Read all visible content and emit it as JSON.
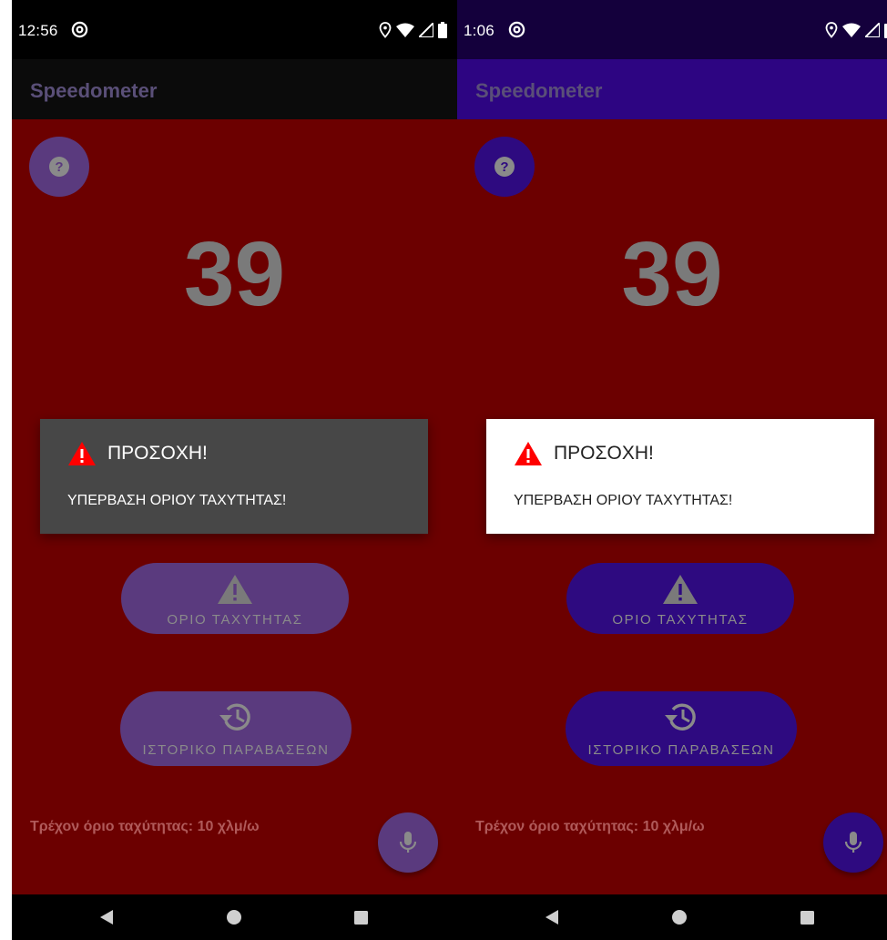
{
  "left": {
    "time": "12:56",
    "app_title": "Speedometer",
    "speed": "39",
    "dialog_title": "ΠΡΟΣΟΧΗ!",
    "dialog_message": "ΥΠΕΡΒΑΣΗ ΟΡΙΟΥ ΤΑΧΥΤΗΤΑΣ!",
    "speed_limit_button": "ΟΡΙΟ ΤΑΧΥΤΗΤΑΣ",
    "history_button": "ΙΣΤΟΡΙΚΟ ΠΑΡΑΒΑΣΕΩΝ",
    "current_limit_text": "Τρέχον όριο ταχύτητας: 10 χλμ/ω"
  },
  "right": {
    "time": "1:06",
    "app_title": "Speedometer",
    "speed": "39",
    "dialog_title": "ΠΡΟΣΟΧΗ!",
    "dialog_message": "ΥΠΕΡΒΑΣΗ ΟΡΙΟΥ ΤΑΧΥΤΗΤΑΣ!",
    "speed_limit_button": "ΟΡΙΟ ΤΑΧΥΤΗΤΑΣ",
    "history_button": "ΙΣΤΟΡΙΚΟ ΠΑΡΑΒΑΣΕΩΝ",
    "current_limit_text": "Τρέχον όριο ταχύτητας: 10 χλμ/ω"
  },
  "icons": {
    "status": [
      "at-sign-icon",
      "location-icon",
      "wifi-icon",
      "signal-icon",
      "battery-icon"
    ],
    "help": "help-icon",
    "warning": "warning-icon",
    "history": "history-icon",
    "mic": "mic-icon",
    "nav": [
      "back-icon",
      "home-icon",
      "recents-icon"
    ]
  },
  "colors": {
    "content_bg": "#6c0000",
    "left_status_bar": "#000000",
    "left_app_bar": "#0b0b0b",
    "left_dialog_bg": "#474747",
    "left_accent": "#5a3a7e",
    "right_status_bar": "#14003c",
    "right_app_bar": "#2d0582",
    "right_dialog_bg": "#ffffff",
    "right_accent": "#2e0a80",
    "warning_red": "#ff0000"
  }
}
